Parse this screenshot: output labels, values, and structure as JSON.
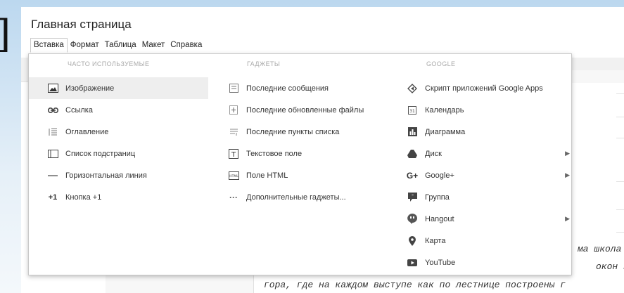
{
  "page": {
    "title": "Главная страница"
  },
  "menubar": {
    "items": [
      {
        "label": "Вставка",
        "active": true
      },
      {
        "label": "Формат"
      },
      {
        "label": "Таблица"
      },
      {
        "label": "Макет"
      },
      {
        "label": "Справка"
      }
    ]
  },
  "insert_menu": {
    "columns": [
      {
        "header": "ЧАСТО ИСПОЛЬЗУЕМЫЕ",
        "items": [
          {
            "label": "Изображение",
            "icon": "image-icon",
            "selected": true
          },
          {
            "label": "Ссылка",
            "icon": "link-icon"
          },
          {
            "label": "Оглавление",
            "icon": "table-of-contents-icon"
          },
          {
            "label": "Список подстраниц",
            "icon": "subpages-icon"
          },
          {
            "label": "Горизонтальная линия",
            "icon": "horizontal-line-icon"
          },
          {
            "label": "Кнопка +1",
            "icon": "plus-one-icon"
          }
        ]
      },
      {
        "header": "ГАДЖЕТЫ",
        "items": [
          {
            "label": "Последние сообщения",
            "icon": "recent-posts-icon"
          },
          {
            "label": "Последние обновленные файлы",
            "icon": "recent-files-icon"
          },
          {
            "label": "Последние пункты списка",
            "icon": "recent-list-icon"
          },
          {
            "label": "Текстовое поле",
            "icon": "text-box-icon"
          },
          {
            "label": "Поле HTML",
            "icon": "html-box-icon"
          },
          {
            "label": "Дополнительные гаджеты...",
            "icon": "more-icon"
          }
        ]
      },
      {
        "header": "GOOGLE",
        "items": [
          {
            "label": "Скрипт приложений Google Apps",
            "icon": "apps-script-icon"
          },
          {
            "label": "Календарь",
            "icon": "calendar-icon"
          },
          {
            "label": "Диаграмма",
            "icon": "chart-icon"
          },
          {
            "label": "Диск",
            "icon": "drive-icon",
            "submenu": true
          },
          {
            "label": "Google+",
            "icon": "google-plus-icon",
            "submenu": true
          },
          {
            "label": "Группа",
            "icon": "group-icon"
          },
          {
            "label": "Hangout",
            "icon": "hangout-icon",
            "submenu": true
          },
          {
            "label": "Карта",
            "icon": "map-pin-icon"
          },
          {
            "label": "YouTube",
            "icon": "youtube-icon"
          }
        ]
      }
    ]
  },
  "document": {
    "lines": [
      "ма школа",
      "окон вы",
      "гора, где на каждом выступе как по лестнице построены г"
    ]
  },
  "colors": {
    "menu_border": "#c8c8c8",
    "selected_bg": "#eeeeee",
    "header_text": "#aaaaaa"
  }
}
